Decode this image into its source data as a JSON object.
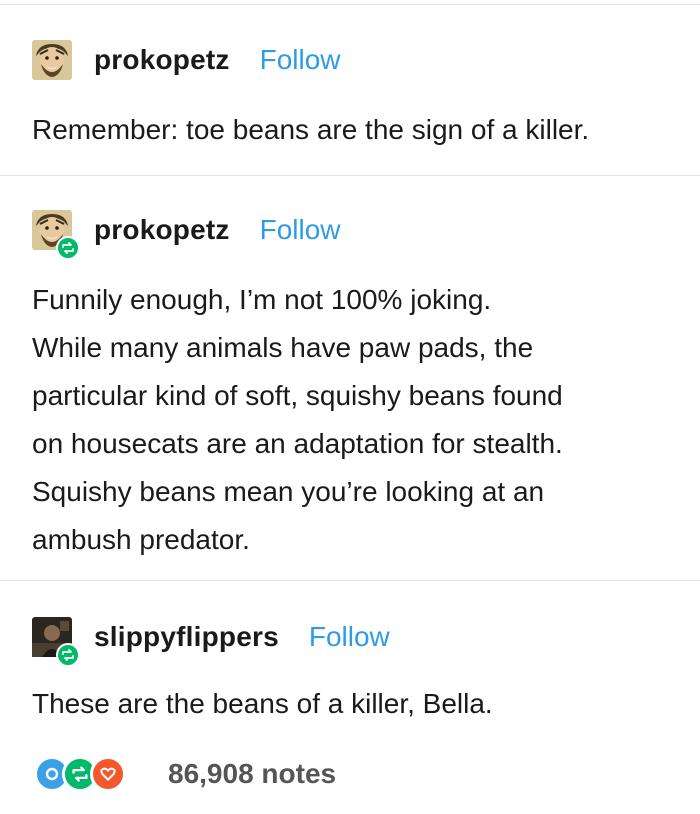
{
  "posts": [
    {
      "username": "prokopetz",
      "follow_label": "Follow",
      "reblogged": false,
      "avatar": "bearded-man-portrait",
      "lines": [
        "Remember: toe beans are the sign of a killer."
      ]
    },
    {
      "username": "prokopetz",
      "follow_label": "Follow",
      "reblogged": true,
      "avatar": "bearded-man-portrait",
      "lines": [
        "Funnily enough, I’m not 100% joking.",
        "While many animals have paw pads, the",
        "particular kind of soft, squishy beans found",
        "on housecats are an adaptation for stealth.",
        "Squishy beans mean you’re looking at an",
        "ambush predator."
      ]
    },
    {
      "username": "slippyflippers",
      "follow_label": "Follow",
      "reblogged": true,
      "avatar": "dark-photo-portrait",
      "lines": [
        "These are the beans of a killer, Bella."
      ]
    }
  ],
  "notes": {
    "count_label": "86,908 notes",
    "icons": [
      {
        "name": "comment-icon",
        "color": "#3aa0e8"
      },
      {
        "name": "reblog-icon",
        "color": "#00b96b"
      },
      {
        "name": "heart-icon",
        "color": "#f2582c"
      }
    ]
  },
  "colors": {
    "follow": "#2f9be6",
    "reblog_badge": "#00b96b",
    "divider": "#e4e4e4"
  }
}
